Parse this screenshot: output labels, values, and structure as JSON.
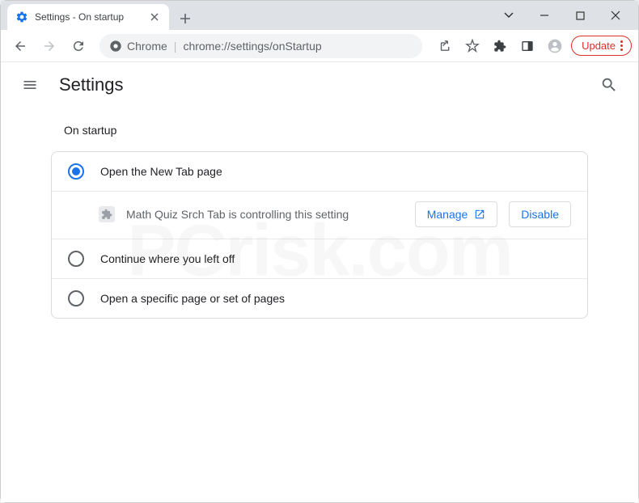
{
  "window": {
    "tab_title": "Settings - On startup",
    "update_label": "Update"
  },
  "address": {
    "scheme_label": "Chrome",
    "url": "chrome://settings/onStartup"
  },
  "settings": {
    "header_title": "Settings",
    "section_title": "On startup",
    "options": [
      {
        "label": "Open the New Tab page",
        "checked": true
      },
      {
        "label": "Continue where you left off",
        "checked": false
      },
      {
        "label": "Open a specific page or set of pages",
        "checked": false
      }
    ],
    "extension": {
      "message": "Math Quiz Srch Tab is controlling this setting",
      "manage_label": "Manage",
      "disable_label": "Disable"
    }
  },
  "watermark": {
    "text": "PCrisk.com"
  }
}
